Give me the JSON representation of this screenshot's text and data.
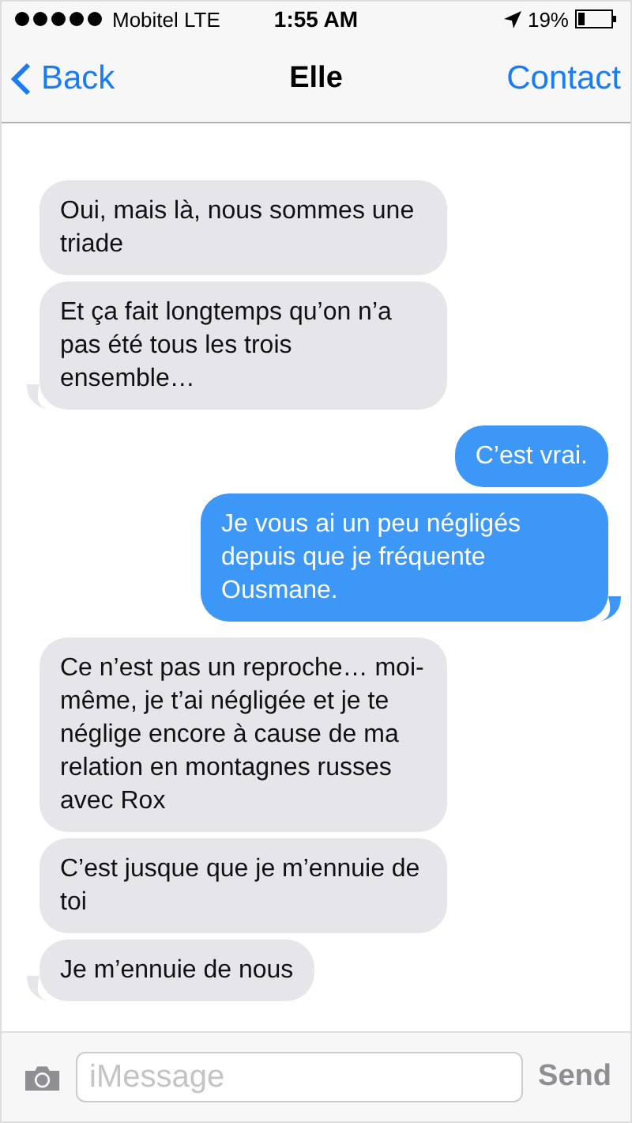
{
  "status_bar": {
    "carrier": "Mobitel LTE",
    "time": "1:55 AM",
    "battery": "19%"
  },
  "nav": {
    "back": "Back",
    "title": "Elle",
    "action": "Contact"
  },
  "messages": [
    {
      "kind": "received",
      "text": "Oui, mais là, nous sommes une triade",
      "tail": false
    },
    {
      "kind": "received",
      "text": "Et ça fait longtemps qu’on n’a pas été tous les trois ensemble…",
      "tail": true
    },
    {
      "kind": "sent",
      "text": "C’est vrai.",
      "tail": false
    },
    {
      "kind": "sent",
      "text": "Je vous ai un peu négligés depuis que je fréquente Ousmane.",
      "tail": true
    },
    {
      "kind": "received",
      "text": "Ce n’est pas un reproche… moi-même, je t’ai négligée et je te néglige encore à cause de ma relation en montagnes russes avec Rox",
      "tail": false
    },
    {
      "kind": "received",
      "text": "C’est jusque que je m’ennuie de toi",
      "tail": false
    },
    {
      "kind": "received",
      "text": "Je m’ennuie de nous",
      "tail": true
    }
  ],
  "composer": {
    "placeholder": "iMessage",
    "send": "Send"
  }
}
